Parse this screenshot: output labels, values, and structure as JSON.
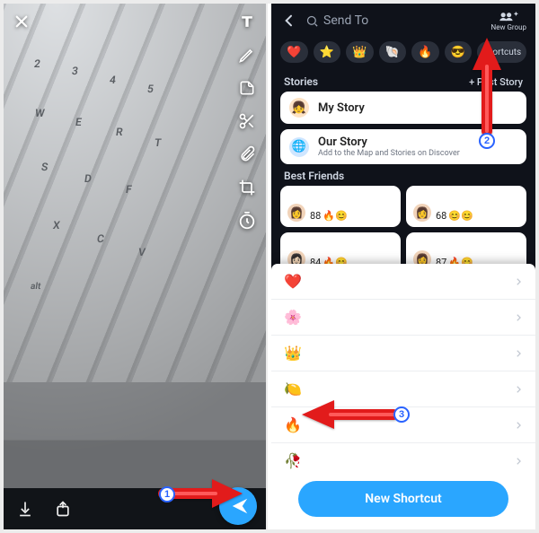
{
  "icon_glyphs": {
    "close-icon": "×",
    "text-tool-icon": "T",
    "pencil-icon": "pencil",
    "sticker-icon": "sticker",
    "scissors-icon": "scissors",
    "attachment-icon": "paperclip",
    "crop-icon": "crop",
    "timer-icon": "timer",
    "save-icon": "download",
    "export-icon": "share-square",
    "send-icon": "paper-plane"
  },
  "colors": {
    "accent_blue": "#2aa6ff",
    "annotation_red": "#e21b1b",
    "badge_border": "#2a63ff"
  },
  "left_pane": {
    "photo_subject": "laptop keyboard",
    "close_label": "Close",
    "tools": [
      {
        "name": "text-tool-icon",
        "label": "Text"
      },
      {
        "name": "pencil-icon",
        "label": "Draw"
      },
      {
        "name": "sticker-icon",
        "label": "Stickers"
      },
      {
        "name": "scissors-icon",
        "label": "Scissors"
      },
      {
        "name": "attachment-icon",
        "label": "Attach"
      },
      {
        "name": "crop-icon",
        "label": "Crop"
      },
      {
        "name": "timer-icon",
        "label": "Timer"
      }
    ],
    "bottom": {
      "save_label": "Save",
      "export_label": "Story",
      "send_label": "Send"
    }
  },
  "right_pane": {
    "header": {
      "back_label": "Back",
      "search_placeholder": "Send To",
      "new_group_label": "New Group"
    },
    "pill_row": {
      "pills": [
        "❤️",
        "⭐",
        "👑",
        "🐚",
        "🔥",
        "😎"
      ],
      "shortcuts_label": "Shortcuts"
    },
    "stories": {
      "title": "Stories",
      "add_label": "+ Post Story",
      "items": [
        {
          "emoji": "👧",
          "title": "My Story",
          "subtitle": ""
        },
        {
          "emoji": "🌐",
          "title": "Our Story",
          "subtitle": "Add to the Map and Stories on Discover"
        }
      ]
    },
    "best_friends": {
      "title": "Best Friends",
      "cells": [
        {
          "avatar": "👩",
          "streak": "88",
          "emojis": "🔥😊"
        },
        {
          "avatar": "👩",
          "streak": "68",
          "emojis": "😊😊"
        },
        {
          "avatar": "👩🏻",
          "streak": "84",
          "emojis": "🔥😊"
        },
        {
          "avatar": "👩",
          "streak": "87",
          "emojis": "🔥😊"
        }
      ]
    },
    "sheet": {
      "items": [
        "❤️",
        "🌸",
        "👑",
        "🍋",
        "🔥",
        "🥀"
      ],
      "button_label": "New Shortcut"
    }
  },
  "annotations": {
    "badges": [
      "1",
      "2",
      "3"
    ]
  }
}
